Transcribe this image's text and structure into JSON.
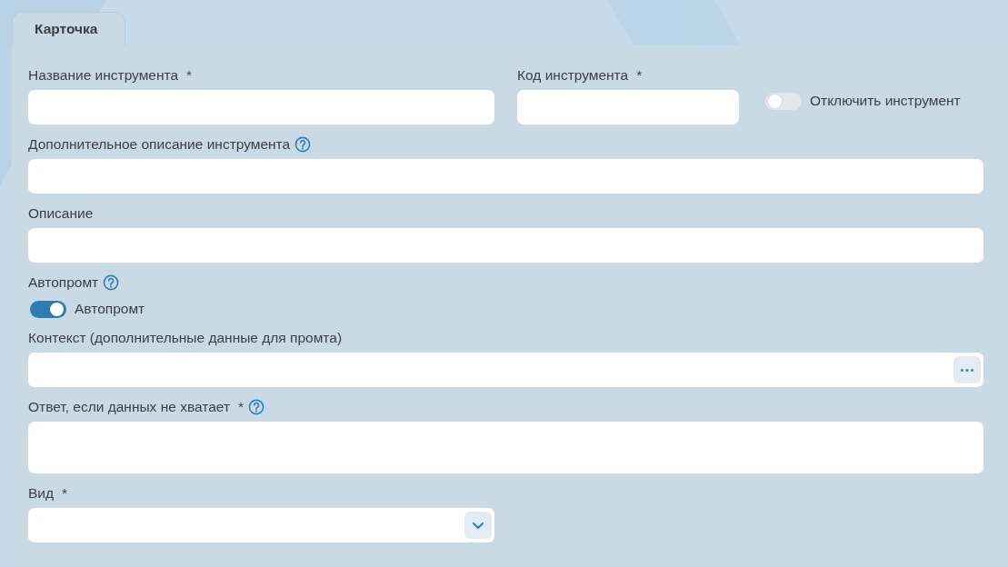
{
  "tabs": [
    {
      "label": "Карточка",
      "selected": true
    }
  ],
  "rows": [
    {
      "items": [
        {
          "kind": "text",
          "label": "Название инструмента",
          "required_mark": "*",
          "help": false
        },
        {
          "kind": "text",
          "label": "Код инструмента",
          "required_mark": "*",
          "help": false
        },
        {
          "kind": "switch",
          "label": "Отключить инструмент",
          "on": false
        }
      ]
    },
    {
      "items": [
        {
          "kind": "text",
          "label": "Дополнительное описание инструмента",
          "help": true
        }
      ]
    },
    {
      "items": [
        {
          "kind": "text",
          "label": "Описание",
          "help": false
        }
      ]
    },
    {
      "items": [
        {
          "kind": "switch",
          "heading": "Автопромт",
          "help": true,
          "label": "Автопромт",
          "on": true
        }
      ]
    },
    {
      "items": [
        {
          "kind": "picker",
          "label": "Контекст (дополнительные данные для промта)",
          "help": false
        }
      ]
    },
    {
      "items": [
        {
          "kind": "textarea",
          "label": "Ответ, если данных не хватает",
          "required_mark": "*",
          "help": true
        }
      ]
    },
    {
      "items": [
        {
          "kind": "select",
          "label": "Вид",
          "required_mark": "*",
          "help": false
        }
      ]
    }
  ]
}
